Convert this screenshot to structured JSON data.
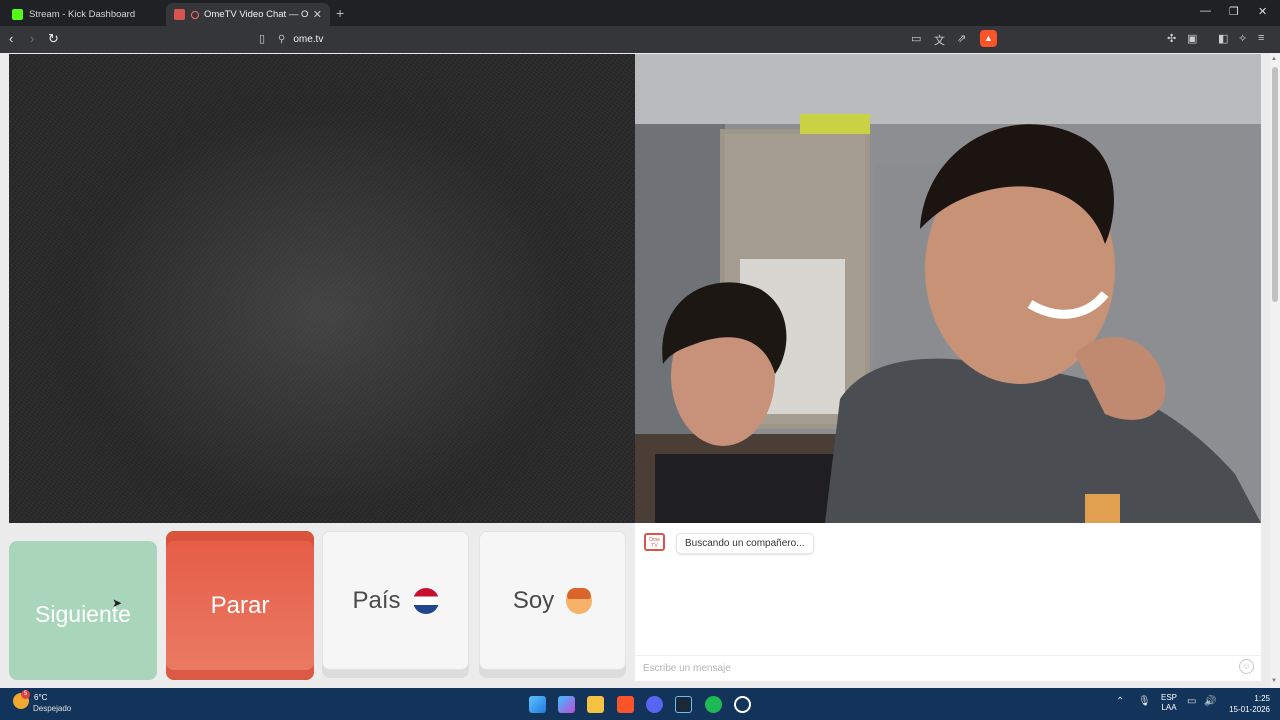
{
  "browser": {
    "tabs": [
      {
        "title": "Stream - Kick Dashboard",
        "active": false
      },
      {
        "title": "OmeTV Video Chat — Omegl",
        "active": true
      }
    ],
    "url": "ome.tv"
  },
  "controls": {
    "next_label": "Siguiente",
    "stop_label": "Parar",
    "country_label": "País",
    "gender_label": "Soy"
  },
  "chat": {
    "logo_text": "Ome TV",
    "status_message": "Buscando un compañero...",
    "input_placeholder": "Escribe un mensaje"
  },
  "taskbar": {
    "weather_temp": "6°C",
    "weather_desc": "Despejado",
    "weather_badge": "5",
    "language": "ESP",
    "layout": "LAA",
    "time": "1:25",
    "date": "15-01-2026"
  },
  "colors": {
    "next": "#a9d6bb",
    "stop": "#e8654f",
    "taskbar": "#12335a"
  }
}
